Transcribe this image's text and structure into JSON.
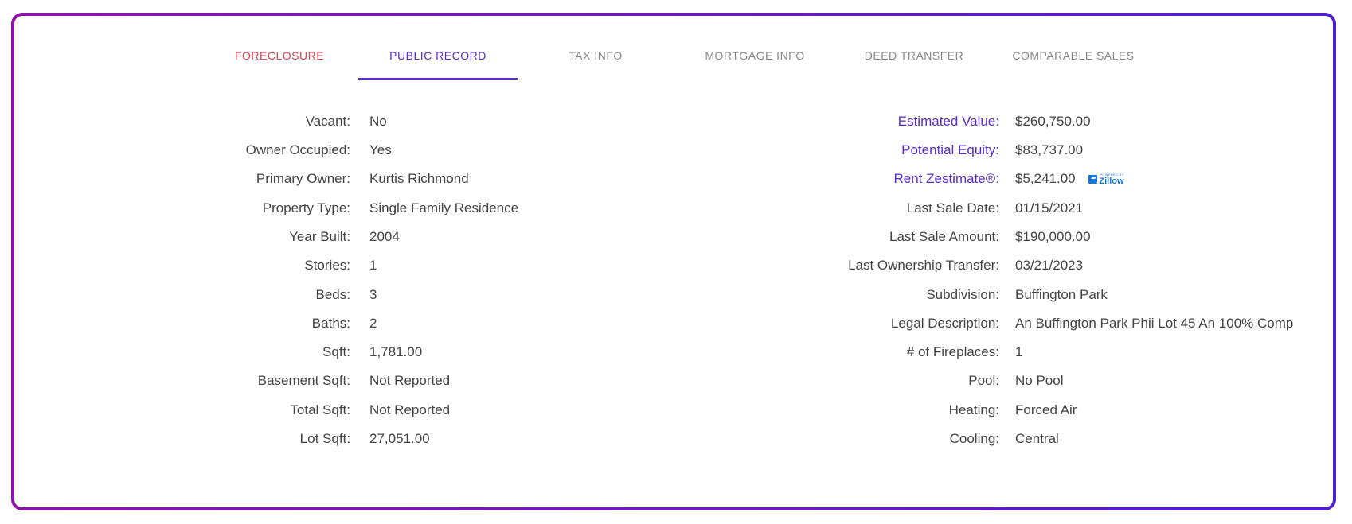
{
  "tabs": [
    {
      "label": "FORECLOSURE"
    },
    {
      "label": "PUBLIC RECORD"
    },
    {
      "label": "TAX INFO"
    },
    {
      "label": "MORTGAGE INFO"
    },
    {
      "label": "DEED TRANSFER"
    },
    {
      "label": "COMPARABLE SALES"
    }
  ],
  "active_tab": "PUBLIC RECORD",
  "left_fields": [
    {
      "label": "Vacant:",
      "value": "No"
    },
    {
      "label": "Owner Occupied:",
      "value": "Yes"
    },
    {
      "label": "Primary Owner:",
      "value": "Kurtis Richmond"
    },
    {
      "label": "Property Type:",
      "value": "Single Family Residence"
    },
    {
      "label": "Year Built:",
      "value": "2004"
    },
    {
      "label": "Stories:",
      "value": "1"
    },
    {
      "label": "Beds:",
      "value": "3"
    },
    {
      "label": "Baths:",
      "value": "2"
    },
    {
      "label": "Sqft:",
      "value": "1,781.00"
    },
    {
      "label": "Basement Sqft:",
      "value": "Not Reported"
    },
    {
      "label": "Total Sqft:",
      "value": "Not Reported"
    },
    {
      "label": "Lot Sqft:",
      "value": "27,051.00"
    }
  ],
  "right_fields": [
    {
      "label": "Estimated Value:",
      "value": "$260,750.00"
    },
    {
      "label": "Potential Equity:",
      "value": "$83,737.00"
    },
    {
      "label": "Rent Zestimate®:",
      "value": "$5,241.00"
    },
    {
      "label": "Last Sale Date:",
      "value": "01/15/2021"
    },
    {
      "label": "Last Sale Amount:",
      "value": "$190,000.00"
    },
    {
      "label": "Last Ownership Transfer:",
      "value": "03/21/2023"
    },
    {
      "label": "Subdivision:",
      "value": "Buffington Park"
    },
    {
      "label": "Legal Description:",
      "value": "An Buffington Park Phii Lot 45 An 100% Comp"
    },
    {
      "label": "# of Fireplaces:",
      "value": "1"
    },
    {
      "label": "Pool:",
      "value": "No Pool"
    },
    {
      "label": "Heating:",
      "value": "Forced Air"
    },
    {
      "label": "Cooling:",
      "value": "Central"
    }
  ],
  "zillow_badge": {
    "small_text": "POWERED BY",
    "text": "Zillow"
  },
  "colors": {
    "accent": "#5a2cd1",
    "foreclosure_tab": "#e53e4f",
    "inactive_tab": "#888888",
    "frame_gradient_start": "#8b16a6",
    "frame_gradient_end": "#4f1fc9",
    "zillow_blue": "#1277e1"
  }
}
